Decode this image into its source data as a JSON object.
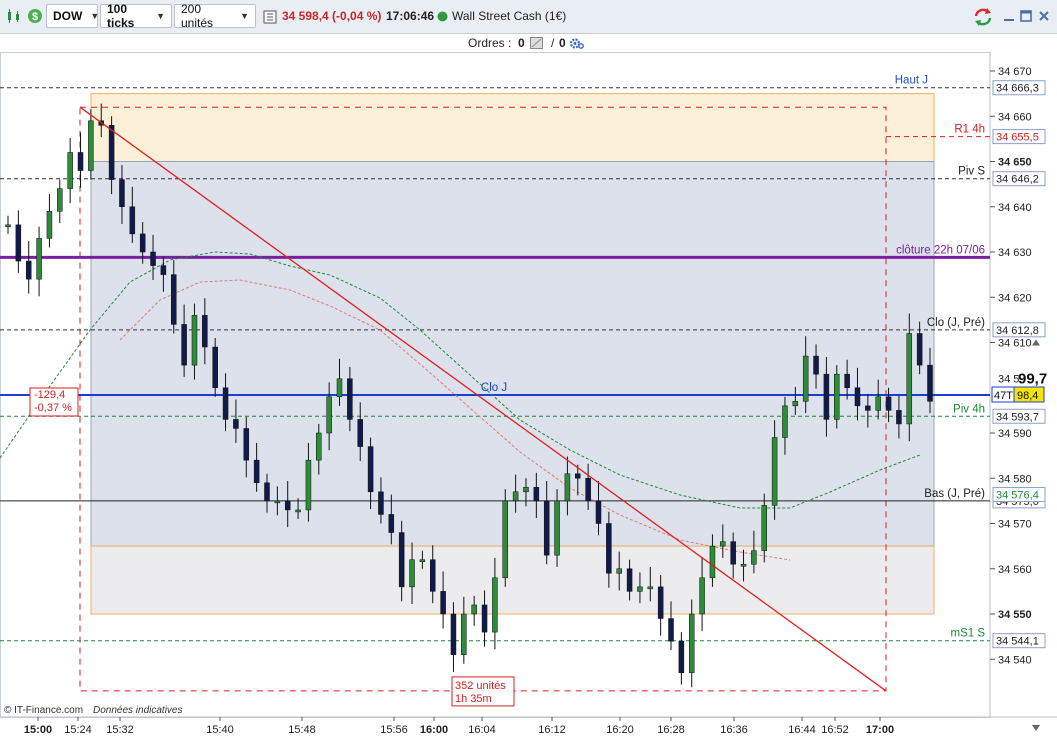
{
  "toolbar": {
    "instrument": "DOW",
    "ticks": "100 ticks",
    "units": "200 unités",
    "price": "34 598,4 (-0,04 %)",
    "time": "17:06:46",
    "market_name": "Wall Street Cash (1€)"
  },
  "orders": {
    "label": "Ordres :",
    "count_left": "0",
    "separator": "/",
    "count_right": "0"
  },
  "price_axis": {
    "ticks": [
      {
        "label": "34 670",
        "value": 34670,
        "bold": false
      },
      {
        "label": "34 660",
        "value": 34660,
        "bold": false
      },
      {
        "label": "34 650",
        "value": 34650,
        "bold": true
      },
      {
        "label": "34 640",
        "value": 34640,
        "bold": false
      },
      {
        "label": "34 630",
        "value": 34630,
        "bold": false
      },
      {
        "label": "34 620",
        "value": 34620,
        "bold": false
      },
      {
        "label": "34 610",
        "value": 34610,
        "bold": false
      },
      {
        "label": "34 590",
        "value": 34590,
        "bold": false
      },
      {
        "label": "34 580",
        "value": 34580,
        "bold": false
      },
      {
        "label": "34 570",
        "value": 34570,
        "bold": false
      },
      {
        "label": "34 560",
        "value": 34560,
        "bold": false
      },
      {
        "label": "34 550",
        "value": 34550,
        "bold": true
      },
      {
        "label": "34 540",
        "value": 34540,
        "bold": false
      }
    ],
    "partial_label": "34 5",
    "current_big": "99,7",
    "current_small": "98,4",
    "counter_label": "47T",
    "range": [
      34534,
      34675
    ]
  },
  "time_axis": [
    {
      "label": "15:00",
      "bold": true
    },
    {
      "label": "15:24",
      "bold": false
    },
    {
      "label": "15:32",
      "bold": false
    },
    {
      "label": "15:40",
      "bold": false
    },
    {
      "label": "15:48",
      "bold": false
    },
    {
      "label": "15:56",
      "bold": false
    },
    {
      "label": "16:00",
      "bold": true
    },
    {
      "label": "16:04",
      "bold": false
    },
    {
      "label": "16:12",
      "bold": false
    },
    {
      "label": "16:20",
      "bold": false
    },
    {
      "label": "16:28",
      "bold": false
    },
    {
      "label": "16:36",
      "bold": false
    },
    {
      "label": "16:44",
      "bold": false
    },
    {
      "label": "16:52",
      "bold": false
    },
    {
      "label": "17:00",
      "bold": true
    }
  ],
  "levels": [
    {
      "name": "Haut J",
      "value": 34666.3,
      "tag": "34 666,3",
      "color": "#1f4fbf",
      "style": "dash-dark"
    },
    {
      "name": "R1 4h",
      "value": 34655.5,
      "tag": "34 655,5",
      "color": "#d42020",
      "style": "dash-red"
    },
    {
      "name": "Piv S",
      "value": 34646.2,
      "tag": "34 646,2",
      "color": "#222222",
      "style": "dash-dark"
    },
    {
      "name": "clôture 22h 07/06",
      "value": 34628.8,
      "tag": "",
      "color": "#7b1fa2",
      "style": "solid-purple"
    },
    {
      "name": "Clo (J, Pré)",
      "value": 34612.8,
      "tag": "34 612,8",
      "color": "#222222",
      "style": "dash-dark"
    },
    {
      "name": "Clo J",
      "value": 34598.4,
      "tag": "",
      "color": "#1a3fd6",
      "style": "solid-blue"
    },
    {
      "name": "Piv 4h",
      "value": 34593.7,
      "tag": "34 593,7",
      "color": "#1b8a3a",
      "style": "dash-green"
    },
    {
      "name": "Bas (J, Pré)",
      "value": 34575.0,
      "tag": "34 575,0",
      "color": "#222222",
      "style": "solid-dark"
    },
    {
      "name": "mS1 S",
      "value": 34544.1,
      "tag": "34 544,1",
      "color": "#1b8a3a",
      "style": "dash-green"
    }
  ],
  "ma_tag": "34 576,4",
  "annotations": {
    "measure_delta": "-129,4",
    "measure_pct": "-0,37 %",
    "measure_units": "352 unités",
    "measure_duration": "1h 35m"
  },
  "footer": {
    "credit": "© IT-Finance.com",
    "note": "Données indicatives"
  },
  "chart_data": {
    "type": "candlestick",
    "ylim": [
      34534,
      34675
    ],
    "x_range": [
      "15:00",
      "17:00"
    ],
    "closes": [
      34636,
      34628,
      34624,
      34633,
      34639,
      34644,
      34652,
      34648,
      34659,
      34658,
      34646,
      34640,
      34634,
      34630,
      34627,
      34625,
      34614,
      34605,
      34616,
      34609,
      34600,
      34593,
      34591,
      34584,
      34579,
      34575,
      34575,
      34573,
      34573,
      34584,
      34590,
      34598,
      34602,
      34593,
      34587,
      34577,
      34572,
      34568,
      34556,
      34562,
      34562,
      34555,
      34550,
      34541,
      34550,
      34552,
      34546,
      34558,
      34575,
      34577,
      34578,
      34575,
      34563,
      34575,
      34581,
      34580,
      34575,
      34570,
      34559,
      34560,
      34555,
      34556,
      34556,
      34549,
      34544,
      34537,
      34550,
      34558,
      34565,
      34566,
      34561,
      34561,
      34564,
      34574,
      34589,
      34596,
      34597,
      34607,
      34603,
      34593,
      34603,
      34600,
      34596,
      34595,
      34598,
      34595,
      34592,
      34612,
      34605,
      34597
    ]
  }
}
